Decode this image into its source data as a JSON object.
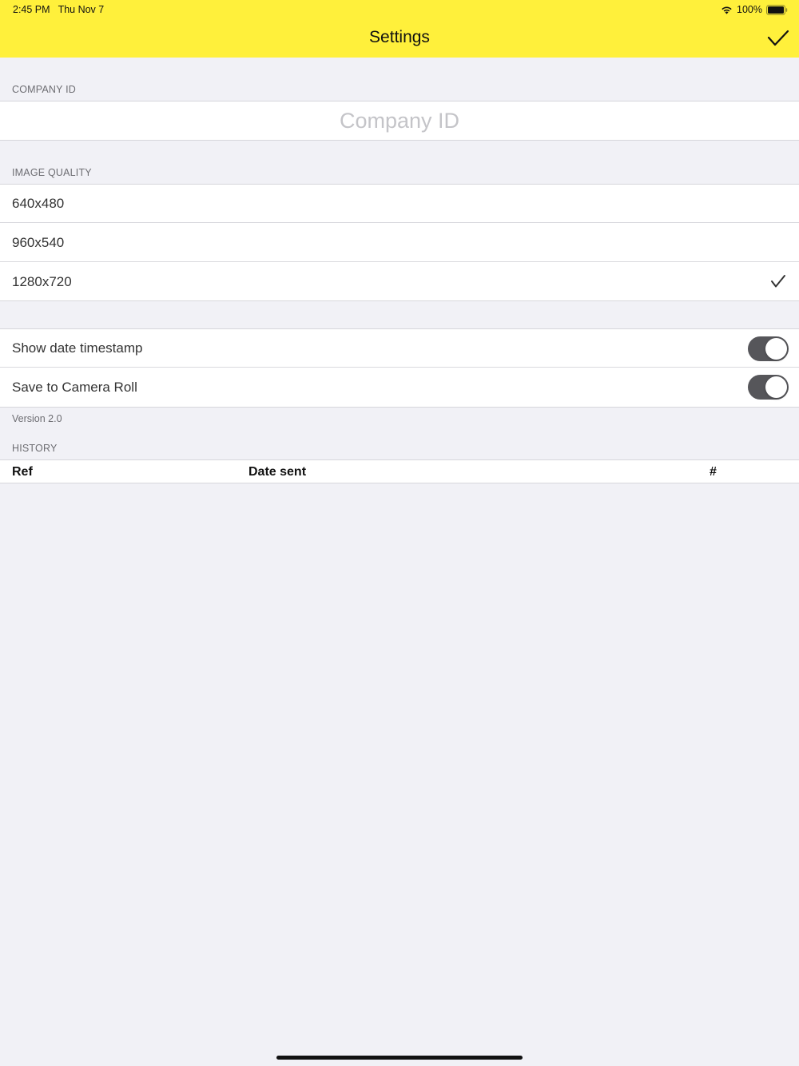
{
  "status_bar": {
    "time": "2:45 PM",
    "date": "Thu Nov 7",
    "battery": "100%",
    "icons": [
      "wifi-icon",
      "battery-icon"
    ]
  },
  "nav": {
    "title": "Settings",
    "done_icon": "checkmark-icon",
    "bar_color": "#fff03b"
  },
  "company": {
    "header": "COMPANY ID",
    "value": "",
    "placeholder": "Company ID"
  },
  "image_quality": {
    "header": "IMAGE QUALITY",
    "options": [
      "640x480",
      "960x540",
      "1280x720"
    ],
    "selected": "1280x720"
  },
  "options": {
    "show_date_timestamp": {
      "label": "Show date timestamp",
      "on": true
    },
    "save_to_camera_roll": {
      "label": "Save to Camera Roll",
      "on": true
    }
  },
  "version": "Version 2.0",
  "history": {
    "header": "HISTORY",
    "columns": [
      "Ref",
      "Date sent",
      "#"
    ],
    "rows": []
  },
  "colors": {
    "background": "#f1f1f6",
    "toggle_on": "#56565a"
  }
}
